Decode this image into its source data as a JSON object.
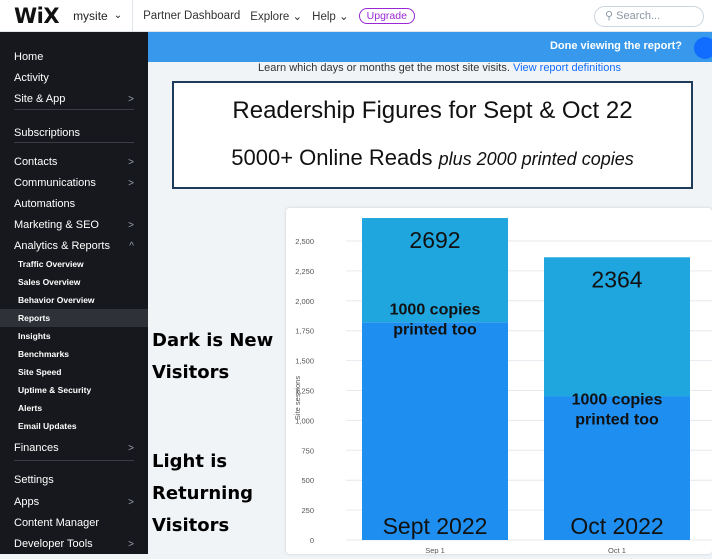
{
  "topbar": {
    "logo": "WiX",
    "site_name": "mysite",
    "links": [
      "Partner Dashboard",
      "Explore",
      "Help"
    ],
    "upgrade": "Upgrade",
    "search_placeholder": "Search..."
  },
  "sidebar": {
    "items": [
      {
        "label": "Home"
      },
      {
        "label": "Activity"
      },
      {
        "label": "Site & App",
        "chevron": true
      },
      {
        "label": "Subscriptions"
      },
      {
        "label": "Contacts",
        "chevron": true
      },
      {
        "label": "Communications",
        "chevron": true
      },
      {
        "label": "Automations"
      },
      {
        "label": "Marketing & SEO",
        "chevron": true
      },
      {
        "label": "Analytics & Reports",
        "expanded": true
      },
      {
        "label": "Traffic Overview",
        "sub": true
      },
      {
        "label": "Sales Overview",
        "sub": true
      },
      {
        "label": "Behavior Overview",
        "sub": true
      },
      {
        "label": "Reports",
        "sub": true,
        "active": true
      },
      {
        "label": "Insights",
        "sub": true
      },
      {
        "label": "Benchmarks",
        "sub": true
      },
      {
        "label": "Site Speed",
        "sub": true
      },
      {
        "label": "Uptime & Security",
        "sub": true
      },
      {
        "label": "Alerts",
        "sub": true
      },
      {
        "label": "Email Updates",
        "sub": true
      },
      {
        "label": "Finances",
        "chevron": true
      },
      {
        "label": "Settings"
      },
      {
        "label": "Apps",
        "chevron": true
      },
      {
        "label": "Content Manager"
      },
      {
        "label": "Developer Tools",
        "chevron": true
      }
    ]
  },
  "banner": {
    "text": "Done viewing the report?"
  },
  "subtext": {
    "text": "Learn which days or months get the most site visits.",
    "link": "View report definitions"
  },
  "title_box": {
    "line1": "Readership Figures for Sept & Oct 22",
    "line2_main": "5000+ Online Reads",
    "line2_italic": "plus 2000 printed copies"
  },
  "annotations": {
    "dark": [
      "Dark is New",
      "Visitors"
    ],
    "light": [
      "Light is",
      "Returning",
      "Visitors"
    ]
  },
  "colors": {
    "new_visitors": "#1e8ff0",
    "returning_visitors": "#1fa6de",
    "sidebar_bg": "#16181d",
    "banner": "#3899ec"
  },
  "chart_data": {
    "type": "bar",
    "stacked": true,
    "categories": [
      "Sep 1",
      "Oct 1"
    ],
    "series": [
      {
        "values": [
          1820,
          1200
        ]
      },
      {
        "values": [
          872,
          1164
        ]
      }
    ],
    "ylabel": "Site sessions",
    "ylim": [
      0,
      2500
    ],
    "yticks": [
      0,
      250,
      500,
      750,
      1000,
      1250,
      1500,
      1750,
      2000,
      2250,
      2500
    ],
    "bar_labels": [
      {
        "total": "2692",
        "note": [
          "1000 copies",
          "printed too"
        ],
        "month": "Sept 2022"
      },
      {
        "total": "2364",
        "note": [
          "1000 copies",
          "printed too"
        ],
        "month": "Oct 2022"
      }
    ],
    "grid": true
  }
}
